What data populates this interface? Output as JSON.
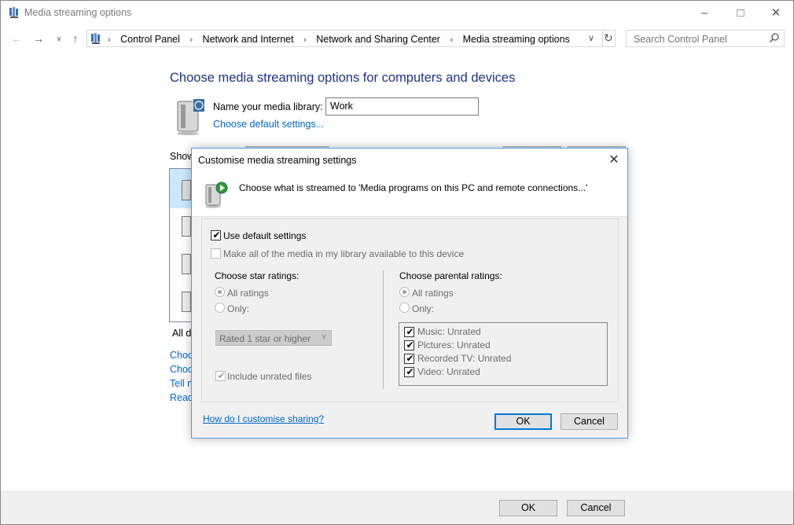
{
  "window": {
    "title": "Media streaming options",
    "minimize_icon": "minimize-icon",
    "maximize_icon": "maximize-icon",
    "close_icon": "close-icon"
  },
  "nav": {
    "breadcrumbs": [
      "Control Panel",
      "Network and Internet",
      "Network and Sharing Center",
      "Media streaming options"
    ],
    "search_placeholder": "Search Control Panel"
  },
  "main": {
    "heading": "Choose media streaming options for computers and devices",
    "library_label": "Name your media library:",
    "library_value": "Work",
    "default_settings_link": "Choose default settings...",
    "show_label": "Show",
    "all_devices_label": "All de",
    "side_links": [
      "Choo",
      "Choo",
      "Tell m",
      "Read"
    ]
  },
  "dialog": {
    "title": "Customise media streaming settings",
    "description": "Choose what is streamed to 'Media programs on this PC and remote connections...'",
    "use_default_label": "Use default settings",
    "use_default_checked": true,
    "make_all_label": "Make all of the media in my library available to this device",
    "make_all_checked": false,
    "star": {
      "heading": "Choose star ratings:",
      "all_label": "All ratings",
      "only_label": "Only:",
      "dropdown_value": "Rated 1 star or higher",
      "include_unrated_label": "Include unrated files",
      "include_unrated_checked": true
    },
    "parental": {
      "heading": "Choose parental ratings:",
      "all_label": "All ratings",
      "only_label": "Only:",
      "items": [
        {
          "label": "Music: Unrated",
          "checked": true
        },
        {
          "label": "Pictures: Unrated",
          "checked": true
        },
        {
          "label": "Recorded TV: Unrated",
          "checked": true
        },
        {
          "label": "Video: Unrated",
          "checked": true
        }
      ]
    },
    "help_link": "How do I customise sharing?",
    "ok_label": "OK",
    "cancel_label": "Cancel"
  },
  "footer": {
    "ok_label": "OK",
    "cancel_label": "Cancel"
  }
}
